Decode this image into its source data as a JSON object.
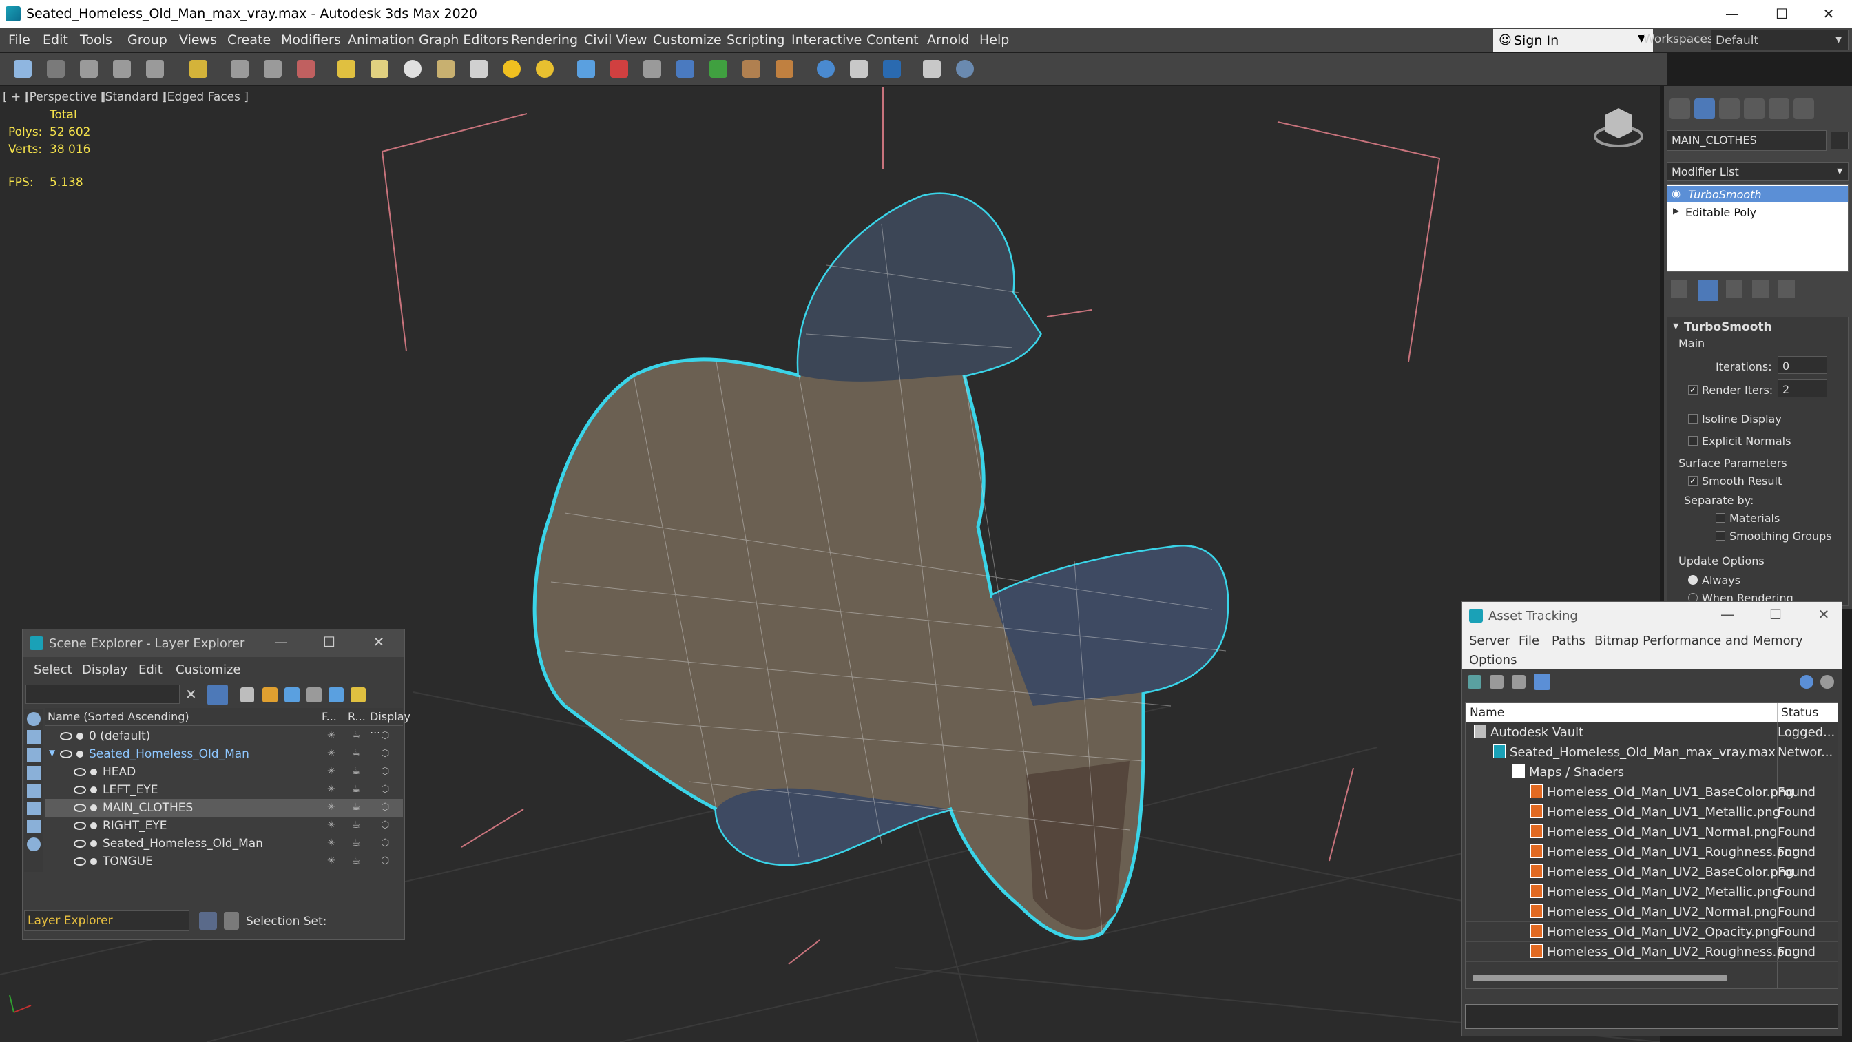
{
  "app": {
    "title": "Seated_Homeless_Old_Man_max_vray.max - Autodesk 3ds Max 2020"
  },
  "menu": [
    "File",
    "Edit",
    "Tools",
    "Group",
    "Views",
    "Create",
    "Modifiers",
    "Animation",
    "Graph Editors",
    "Rendering",
    "Civil View",
    "Customize",
    "Scripting",
    "Interactive",
    "Content",
    "Arnold",
    "Help"
  ],
  "signin": {
    "label": "Sign In"
  },
  "workspaces": {
    "label": "Workspaces:",
    "value": "Default"
  },
  "viewport": {
    "labels": [
      "[ + ]",
      "[Perspective ]",
      "[Standard ]",
      "[Edged Faces ]"
    ],
    "stats": {
      "total_label": "Total",
      "polys_label": "Polys:",
      "polys": "52 602",
      "verts_label": "Verts:",
      "verts": "38 016",
      "fps_label": "FPS:",
      "fps": "5.138"
    }
  },
  "command_panel": {
    "object_name": "MAIN_CLOTHES",
    "modifier_list": "Modifier List",
    "stack": [
      "TurboSmooth",
      "Editable Poly"
    ],
    "rollout": "TurboSmooth",
    "main": "Main",
    "iterations_label": "Iterations:",
    "iterations": "0",
    "render_iters_label": "Render Iters:",
    "render_iters": "2",
    "isoline": "Isoline Display",
    "explicit_normals": "Explicit Normals",
    "surface_params": "Surface Parameters",
    "smooth_result": "Smooth Result",
    "separate_by": "Separate by:",
    "materials": "Materials",
    "smoothing_groups": "Smoothing Groups",
    "update_options": "Update Options",
    "always": "Always",
    "when_rendering": "When Rendering"
  },
  "scene_explorer": {
    "title": "Scene Explorer - Layer Explorer",
    "menu": [
      "Select",
      "Display",
      "Edit",
      "Customize"
    ],
    "columns": [
      "Name (Sorted Ascending)",
      "F...",
      "R...",
      "Display ..."
    ],
    "rows": [
      {
        "name": "0 (default)",
        "indent": 1
      },
      {
        "name": "Seated_Homeless_Old_Man",
        "indent": 1
      },
      {
        "name": "HEAD",
        "indent": 2
      },
      {
        "name": "LEFT_EYE",
        "indent": 2
      },
      {
        "name": "MAIN_CLOTHES",
        "indent": 2
      },
      {
        "name": "RIGHT_EYE",
        "indent": 2
      },
      {
        "name": "Seated_Homeless_Old_Man",
        "indent": 2
      },
      {
        "name": "TONGUE",
        "indent": 2
      }
    ],
    "footer_explorer": "Layer Explorer",
    "selection_set": "Selection Set:"
  },
  "asset_tracking": {
    "title": "Asset Tracking",
    "menu": [
      "Server",
      "File",
      "Paths",
      "Bitmap Performance and Memory",
      "Options"
    ],
    "columns": [
      "Name",
      "Status"
    ],
    "rows": [
      {
        "name": "Autodesk Vault",
        "status": "Logged...",
        "indent": 0
      },
      {
        "name": "Seated_Homeless_Old_Man_max_vray.max",
        "status": "Networ...",
        "indent": 1
      },
      {
        "name": "Maps / Shaders",
        "status": "",
        "indent": 2
      },
      {
        "name": "Homeless_Old_Man_UV1_BaseColor.png",
        "status": "Found",
        "indent": 3
      },
      {
        "name": "Homeless_Old_Man_UV1_Metallic.png",
        "status": "Found",
        "indent": 3
      },
      {
        "name": "Homeless_Old_Man_UV1_Normal.png",
        "status": "Found",
        "indent": 3
      },
      {
        "name": "Homeless_Old_Man_UV1_Roughness.png",
        "status": "Found",
        "indent": 3
      },
      {
        "name": "Homeless_Old_Man_UV2_BaseColor.png",
        "status": "Found",
        "indent": 3
      },
      {
        "name": "Homeless_Old_Man_UV2_Metallic.png",
        "status": "Found",
        "indent": 3
      },
      {
        "name": "Homeless_Old_Man_UV2_Normal.png",
        "status": "Found",
        "indent": 3
      },
      {
        "name": "Homeless_Old_Man_UV2_Opacity.png",
        "status": "Found",
        "indent": 3
      },
      {
        "name": "Homeless_Old_Man_UV2_Roughness.png",
        "status": "Found",
        "indent": 3
      }
    ]
  },
  "colors": {
    "accent": "#5b8fd6",
    "selection_outline": "#3ad4e8",
    "stats_text": "#f5e24b"
  }
}
